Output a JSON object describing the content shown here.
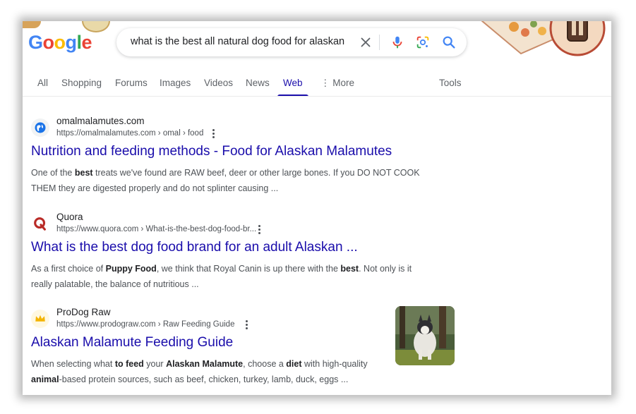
{
  "header": {
    "logo": {
      "g": "G",
      "o1": "o",
      "o2": "o",
      "g2": "g",
      "l": "l",
      "e": "e"
    },
    "search": {
      "query": "what is the best all natural dog food for alaskan",
      "clear_icon": "close-icon",
      "voice_icon": "microphone-icon",
      "lens_icon": "google-lens-icon",
      "search_icon": "search-icon"
    }
  },
  "tabs": {
    "items": [
      "All",
      "Shopping",
      "Forums",
      "Images",
      "Videos",
      "News",
      "Web",
      "More"
    ],
    "active": "Web",
    "tools": "Tools"
  },
  "results": [
    {
      "site": "omalmalamutes.com",
      "url": "https://omalmalamutes.com › omal › food",
      "title": "Nutrition and feeding methods - Food for Alaskan Malamutes",
      "snippet_parts": [
        "One of the ",
        "best",
        " treats we've found are RAW beef, deer or other large bones. If you DO NOT COOK THEM they are digested properly and do not splinter causing ..."
      ],
      "favicon": "globe-icon"
    },
    {
      "site": "Quora",
      "url": "https://www.quora.com › What-is-the-best-dog-food-br...",
      "title": "What is the best dog food brand for an adult Alaskan ...",
      "snippet_parts": [
        "As a first choice of ",
        "Puppy Food",
        ", we think that Royal Canin is up there with the ",
        "best",
        ". Not only is it really palatable, the balance of nutritious ..."
      ],
      "favicon": "quora-logo"
    },
    {
      "site": "ProDog Raw",
      "url": "https://www.prodograw.com › Raw Feeding Guide",
      "title": "Alaskan Malamute Feeding Guide",
      "snippet_parts": [
        "When selecting what ",
        "to feed",
        " your ",
        "Alaskan Malamute",
        ", choose a ",
        "diet",
        " with high-quality ",
        "animal",
        "-based protein sources, such as beef, chicken, turkey, lamb, duck, eggs ..."
      ],
      "favicon": "crown-icon"
    }
  ],
  "colors": {
    "link": "#1a0dab",
    "text": "#4d5156",
    "accent_blue": "#4285f4"
  }
}
